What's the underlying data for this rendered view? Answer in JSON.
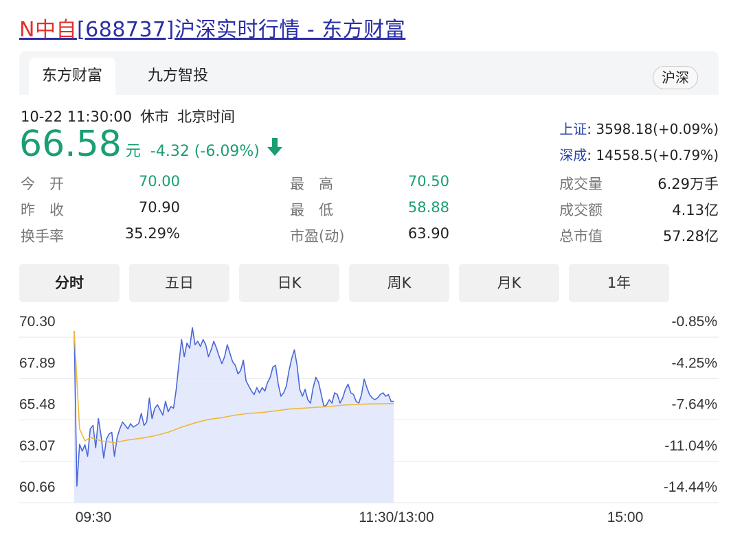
{
  "page_title": {
    "prefix": "N中自",
    "rest": "[688737]沪深实时行情 - 东方财富"
  },
  "tabs": [
    {
      "label": "东方财富",
      "active": true
    },
    {
      "label": "九方智投",
      "active": false
    }
  ],
  "market_chip": "沪深",
  "status": {
    "datetime": "10-22 11:30:00",
    "session": "休市",
    "timezone": "北京时间"
  },
  "quote": {
    "price": "66.58",
    "unit": "元",
    "change": "-4.32 (-6.09%)",
    "direction": "down",
    "color": "#1a9e73"
  },
  "indices": [
    {
      "name": "上证",
      "value": ": 3598.18(+0.09%)"
    },
    {
      "name": "深成",
      "value": ": 14558.5(+0.79%)"
    }
  ],
  "stats": [
    {
      "label": "今　开",
      "value": "70.00",
      "tone": "green"
    },
    {
      "label": "最　高",
      "value": "70.50",
      "tone": "green"
    },
    {
      "label": "成交量",
      "value": "6.29万手",
      "tone": "dark"
    },
    {
      "label": "昨　收",
      "value": "70.90",
      "tone": "dark"
    },
    {
      "label": "最　低",
      "value": "58.88",
      "tone": "green"
    },
    {
      "label": "成交额",
      "value": "4.13亿",
      "tone": "dark"
    },
    {
      "label": "换手率",
      "value": "35.29%",
      "tone": "dark"
    },
    {
      "label": "市盈(动)",
      "value": "63.90",
      "tone": "dark"
    },
    {
      "label": "总市值",
      "value": "57.28亿",
      "tone": "dark"
    }
  ],
  "periods": [
    {
      "label": "分时",
      "active": true
    },
    {
      "label": "五日",
      "active": false
    },
    {
      "label": "日K",
      "active": false
    },
    {
      "label": "周K",
      "active": false
    },
    {
      "label": "月K",
      "active": false
    },
    {
      "label": "1年",
      "active": false
    }
  ],
  "chart_data": {
    "type": "line",
    "x_labels": [
      "09:30",
      "11:30/13:00",
      "15:00"
    ],
    "y_left_ticks": [
      "70.30",
      "67.89",
      "65.48",
      "63.07",
      "60.66"
    ],
    "y_right_ticks": [
      "-0.85%",
      "-4.25%",
      "-7.64%",
      "-11.04%",
      "-14.44%"
    ],
    "ylim": [
      60.66,
      70.3
    ],
    "x_minutes_total": 240,
    "grid": true,
    "series": [
      {
        "role": "price",
        "color": "#4a67d6",
        "fill": "#dfe5fb",
        "points": [
          [
            0,
            69.7
          ],
          [
            1,
            60.66
          ],
          [
            2,
            63.1
          ],
          [
            3,
            62.7
          ],
          [
            4,
            63.07
          ],
          [
            5,
            62.4
          ],
          [
            6,
            64.0
          ],
          [
            7,
            64.2
          ],
          [
            8,
            62.9
          ],
          [
            9,
            64.6
          ],
          [
            10,
            63.6
          ],
          [
            11,
            62.3
          ],
          [
            12,
            63.4
          ],
          [
            13,
            63.7
          ],
          [
            14,
            63.8
          ],
          [
            15,
            62.4
          ],
          [
            16,
            63.5
          ],
          [
            17,
            64.0
          ],
          [
            18,
            64.4
          ],
          [
            19,
            64.2
          ],
          [
            20,
            64.0
          ],
          [
            21,
            64.3
          ],
          [
            22,
            64.1
          ],
          [
            23,
            64.2
          ],
          [
            24,
            64.3
          ],
          [
            25,
            64.9
          ],
          [
            26,
            64.2
          ],
          [
            27,
            64.4
          ],
          [
            28,
            65.8
          ],
          [
            29,
            64.6
          ],
          [
            30,
            65.2
          ],
          [
            31,
            65.4
          ],
          [
            32,
            65.1
          ],
          [
            33,
            64.8
          ],
          [
            34,
            65.6
          ],
          [
            35,
            65.0
          ],
          [
            36,
            65.3
          ],
          [
            37,
            65.2
          ],
          [
            38,
            66.3
          ],
          [
            39,
            67.8
          ],
          [
            40,
            69.2
          ],
          [
            41,
            68.2
          ],
          [
            42,
            69.0
          ],
          [
            43,
            68.7
          ],
          [
            44,
            69.9
          ],
          [
            45,
            68.9
          ],
          [
            46,
            69.1
          ],
          [
            47,
            68.8
          ],
          [
            48,
            69.2
          ],
          [
            49,
            68.9
          ],
          [
            50,
            68.2
          ],
          [
            51,
            68.6
          ],
          [
            52,
            69.1
          ],
          [
            53,
            68.7
          ],
          [
            54,
            68.2
          ],
          [
            55,
            67.8
          ],
          [
            56,
            68.2
          ],
          [
            57,
            68.9
          ],
          [
            58,
            68.4
          ],
          [
            59,
            67.9
          ],
          [
            60,
            67.7
          ],
          [
            61,
            67.2
          ],
          [
            62,
            67.4
          ],
          [
            63,
            68.0
          ],
          [
            64,
            66.8
          ],
          [
            65,
            66.5
          ],
          [
            66,
            66.2
          ],
          [
            67,
            66.0
          ],
          [
            68,
            66.4
          ],
          [
            69,
            66.1
          ],
          [
            70,
            66.4
          ],
          [
            71,
            66.2
          ],
          [
            72,
            66.7
          ],
          [
            73,
            67.0
          ],
          [
            74,
            67.6
          ],
          [
            75,
            67.7
          ],
          [
            76,
            66.6
          ],
          [
            77,
            65.9
          ],
          [
            78,
            66.1
          ],
          [
            79,
            66.5
          ],
          [
            80,
            67.4
          ],
          [
            81,
            68.1
          ],
          [
            82,
            68.6
          ],
          [
            83,
            67.7
          ],
          [
            84,
            66.3
          ],
          [
            85,
            65.9
          ],
          [
            86,
            66.3
          ],
          [
            87,
            65.7
          ],
          [
            88,
            65.5
          ],
          [
            89,
            66.4
          ],
          [
            90,
            67.0
          ],
          [
            91,
            66.7
          ],
          [
            92,
            66.0
          ],
          [
            93,
            65.3
          ],
          [
            94,
            65.4
          ],
          [
            95,
            65.7
          ],
          [
            96,
            65.5
          ],
          [
            97,
            66.1
          ],
          [
            98,
            66.0
          ],
          [
            99,
            65.5
          ],
          [
            100,
            65.8
          ],
          [
            101,
            66.3
          ],
          [
            102,
            66.6
          ],
          [
            103,
            66.1
          ],
          [
            104,
            66.0
          ],
          [
            105,
            65.6
          ],
          [
            106,
            65.5
          ],
          [
            107,
            66.0
          ],
          [
            108,
            66.9
          ],
          [
            109,
            66.4
          ],
          [
            110,
            66.0
          ],
          [
            111,
            65.8
          ],
          [
            112,
            65.7
          ],
          [
            113,
            65.8
          ],
          [
            114,
            66.0
          ],
          [
            115,
            66.1
          ],
          [
            116,
            65.9
          ],
          [
            117,
            66.0
          ],
          [
            118,
            65.6
          ],
          [
            119,
            65.6
          ]
        ]
      },
      {
        "role": "average",
        "color": "#f0b73a",
        "points": [
          [
            0,
            69.7
          ],
          [
            2,
            64.0
          ],
          [
            4,
            63.3
          ],
          [
            6,
            63.5
          ],
          [
            10,
            63.3
          ],
          [
            15,
            63.2
          ],
          [
            20,
            63.35
          ],
          [
            25,
            63.45
          ],
          [
            30,
            63.6
          ],
          [
            35,
            63.8
          ],
          [
            40,
            64.1
          ],
          [
            45,
            64.35
          ],
          [
            50,
            64.55
          ],
          [
            55,
            64.65
          ],
          [
            60,
            64.8
          ],
          [
            65,
            64.9
          ],
          [
            70,
            64.95
          ],
          [
            75,
            65.05
          ],
          [
            80,
            65.15
          ],
          [
            85,
            65.2
          ],
          [
            90,
            65.25
          ],
          [
            95,
            65.3
          ],
          [
            100,
            65.38
          ],
          [
            105,
            65.42
          ],
          [
            110,
            65.45
          ],
          [
            115,
            65.46
          ],
          [
            119,
            65.47
          ]
        ]
      }
    ]
  }
}
